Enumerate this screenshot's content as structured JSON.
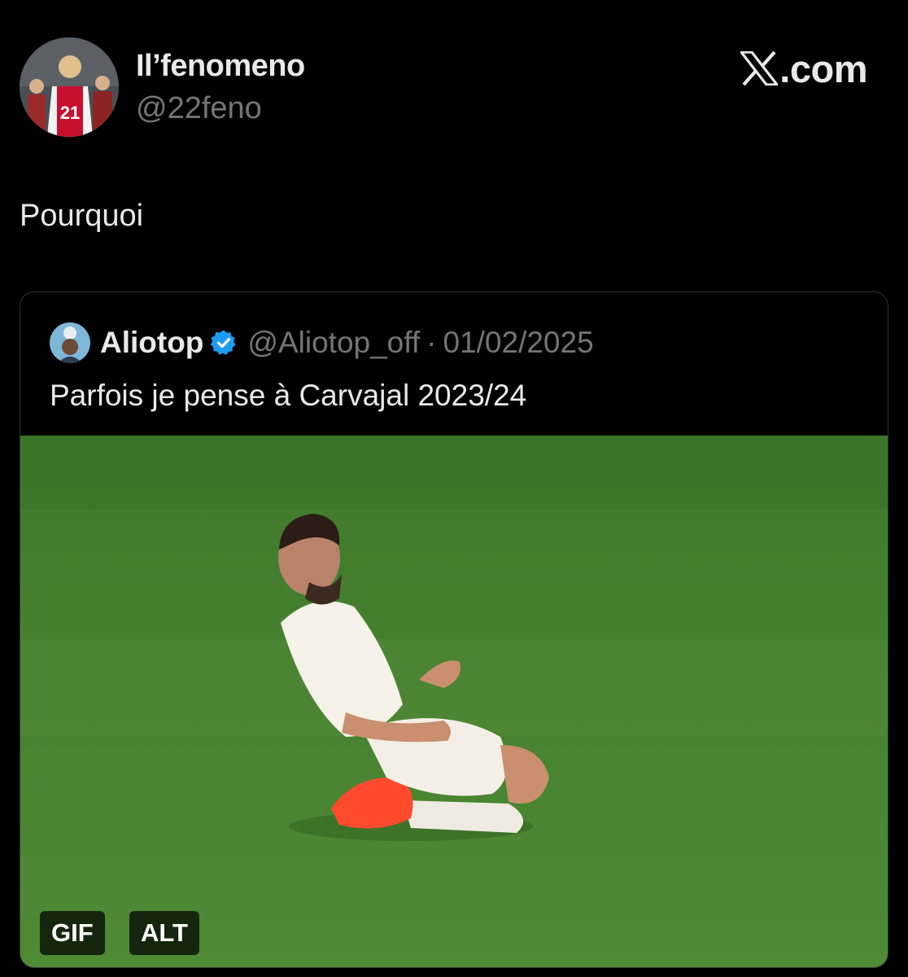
{
  "tweet": {
    "author_name": "Il’fenomeno",
    "author_handle": "@22feno",
    "avatar_icon": "profile-avatar-photo",
    "text": "Pourquoi"
  },
  "site_logo": {
    "icon": "x-logo-icon",
    "domain": ".com"
  },
  "quoted_tweet": {
    "author_name": "Aliotop",
    "verified_icon": "verified-badge-icon",
    "verified_color": "#1d9bf0",
    "author_handle": "@Aliotop_off",
    "separator": "·",
    "date": "01/02/2025",
    "text": "Parfois je pense à Carvajal 2023/24",
    "media": {
      "type": "gif",
      "gif_badge": "GIF",
      "alt_badge": "ALT"
    }
  },
  "colors": {
    "background": "#000000",
    "primary_text": "#e7e9ea",
    "secondary_text": "#71767b",
    "border": "#2f3336",
    "pitch_green": "#4f8a35"
  }
}
